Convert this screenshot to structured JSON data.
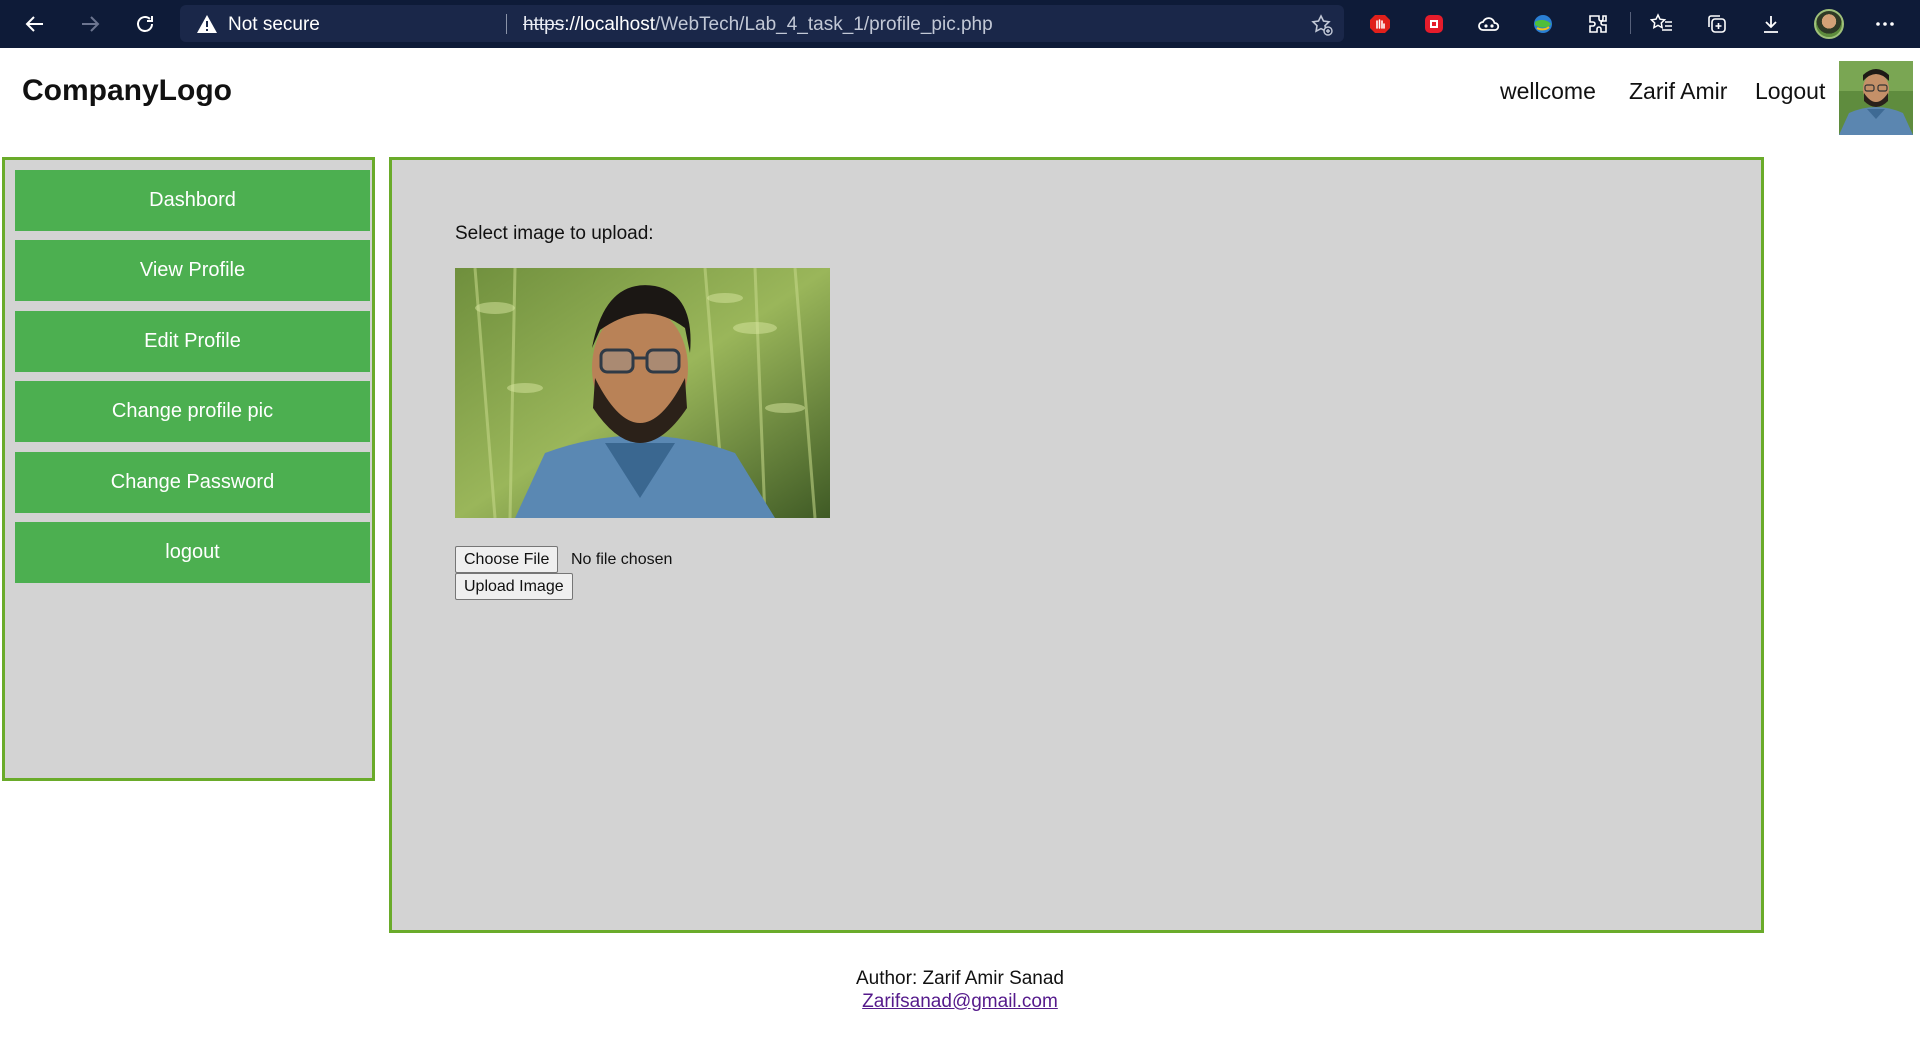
{
  "browser": {
    "security_label": "Not secure",
    "url_protocol": "https",
    "url_host": "://localhost",
    "url_path": "/WebTech/Lab_4_task_1/profile_pic.php",
    "icons": [
      "back-icon",
      "forward-icon",
      "reload-icon",
      "warning-icon",
      "add-favorite-icon",
      "extension-red-hand-icon",
      "extension-red-square-icon",
      "extension-cloud-icon",
      "extension-globe-icon",
      "extensions-puzzle-icon",
      "favorites-icon",
      "collections-icon",
      "downloads-icon",
      "profile-avatar-icon",
      "more-menu-icon"
    ]
  },
  "header": {
    "logo": "CompanyLogo",
    "welcome": "wellcome",
    "username": "Zarif Amir",
    "logout": "Logout"
  },
  "sidebar": {
    "items": [
      {
        "label": "Dashbord"
      },
      {
        "label": "View Profile"
      },
      {
        "label": "Edit Profile"
      },
      {
        "label": "Change profile pic"
      },
      {
        "label": "Change Password"
      },
      {
        "label": "logout"
      }
    ]
  },
  "main": {
    "upload_label": "Select image to upload:",
    "choose_file_label": "Choose File",
    "file_status": "No file chosen",
    "upload_button_label": "Upload Image"
  },
  "footer": {
    "author": "Author: Zarif Amir Sanad",
    "email": "Zarifsanad@gmail.com"
  },
  "colors": {
    "chrome_bg": "#0e1b38",
    "accent_green": "#4caf50",
    "border_green": "#6aab2a",
    "panel_gray": "#d3d3d3",
    "link_purple": "#551a8b"
  }
}
